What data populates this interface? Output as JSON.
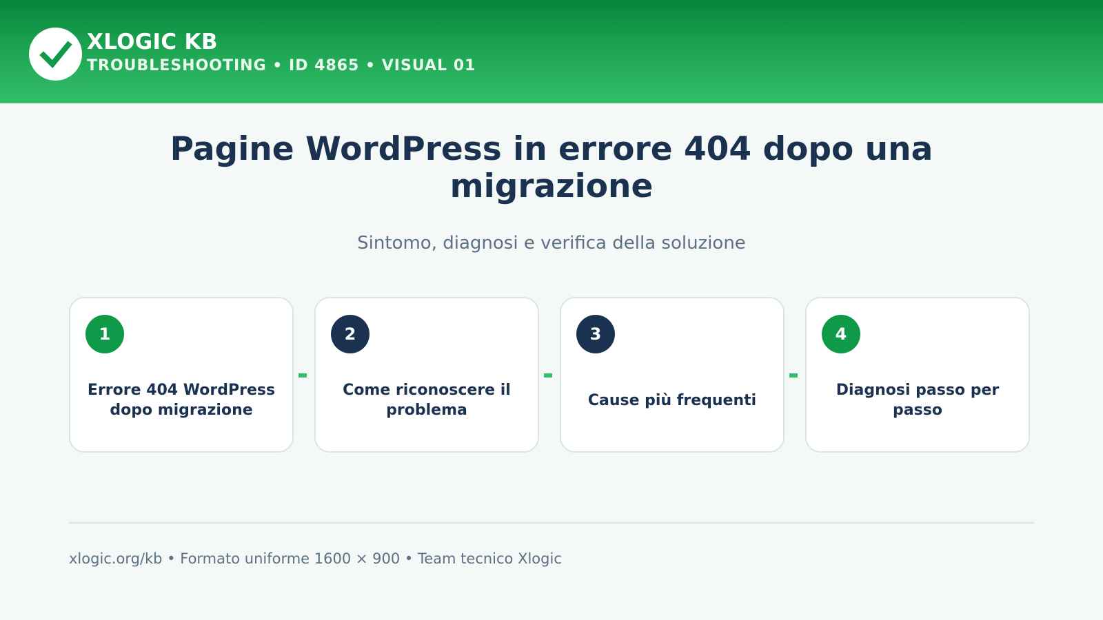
{
  "header": {
    "brand_name": "XLOGIC KB",
    "brand_sub": "TROUBLESHOOTING • ID 4865 • VISUAL 01",
    "logo_icon": "checkmark-icon",
    "colors": {
      "green_dark": "#06853b",
      "green_light": "#34bd6a"
    }
  },
  "main": {
    "title": "Pagine WordPress in errore 404 dopo una migrazione",
    "subtitle": "Sintomo, diagnosi e verifica della soluzione"
  },
  "steps": [
    {
      "number": "1",
      "label": "Errore 404 WordPress dopo migrazione",
      "badge_color": "#0e9a48"
    },
    {
      "number": "2",
      "label": "Come riconoscere il problema",
      "badge_color": "#1a3150"
    },
    {
      "number": "3",
      "label": "Cause più frequenti",
      "badge_color": "#1a3150"
    },
    {
      "number": "4",
      "label": "Diagnosi passo per passo",
      "badge_color": "#0e9a48"
    }
  ],
  "footer": {
    "text": "xlogic.org/kb • Formato uniforme 1600 × 900 • Team tecnico Xlogic"
  }
}
